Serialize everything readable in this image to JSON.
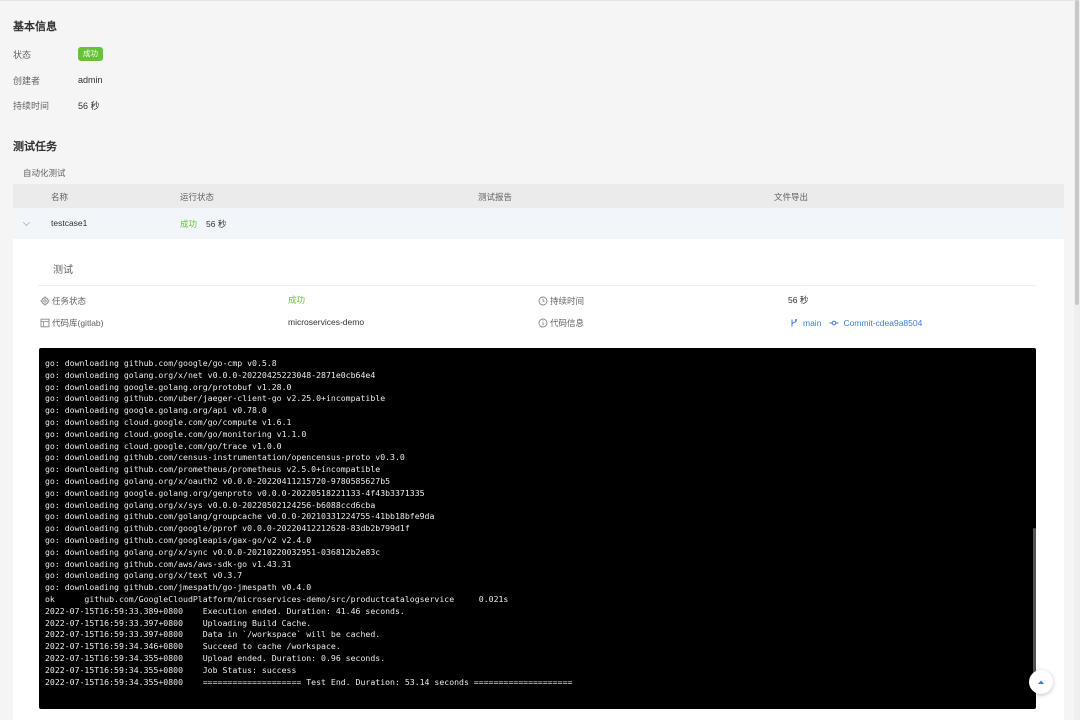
{
  "basic_info": {
    "title": "基本信息",
    "rows": [
      {
        "label": "状态",
        "value": "成功"
      },
      {
        "label": "创建者",
        "value": "admin"
      },
      {
        "label": "持续时间",
        "value": "56 秒"
      }
    ]
  },
  "test_tasks": {
    "title": "测试任务",
    "subsection": "自动化测试",
    "columns": [
      "名称",
      "运行状态",
      "测试报告",
      "文件导出"
    ],
    "row": {
      "name": "testcase1",
      "status": "成功",
      "duration": "56 秒"
    }
  },
  "detail": {
    "title": "测试",
    "task_status_label": "任务状态",
    "task_status_value": "成功",
    "duration_label": "持续时间",
    "duration_value": "56 秒",
    "repo_label": "代码库(gitlab)",
    "repo_value": "microservices-demo",
    "code_info_label": "代码信息",
    "branch": "main",
    "commit": "Commit-cdea9a8504"
  },
  "terminal_lines": [
    "go: downloading github.com/google/go-cmp v0.5.8",
    "go: downloading golang.org/x/net v0.0.0-20220425223048-2871e0cb64e4",
    "go: downloading google.golang.org/protobuf v1.28.0",
    "go: downloading github.com/uber/jaeger-client-go v2.25.0+incompatible",
    "go: downloading google.golang.org/api v0.78.0",
    "go: downloading cloud.google.com/go/compute v1.6.1",
    "go: downloading cloud.google.com/go/monitoring v1.1.0",
    "go: downloading cloud.google.com/go/trace v1.0.0",
    "go: downloading github.com/census-instrumentation/opencensus-proto v0.3.0",
    "go: downloading github.com/prometheus/prometheus v2.5.0+incompatible",
    "go: downloading golang.org/x/oauth2 v0.0.0-20220411215720-9780585627b5",
    "go: downloading google.golang.org/genproto v0.0.0-20220518221133-4f43b3371335",
    "go: downloading golang.org/x/sys v0.0.0-20220502124256-b6088ccd6cba",
    "go: downloading github.com/golang/groupcache v0.0.0-20210331224755-41bb18bfe9da",
    "go: downloading github.com/google/pprof v0.0.0-20220412212628-83db2b799d1f",
    "go: downloading github.com/googleapis/gax-go/v2 v2.4.0",
    "go: downloading golang.org/x/sync v0.0.0-20210220032951-036812b2e83c",
    "go: downloading github.com/aws/aws-sdk-go v1.43.31",
    "go: downloading golang.org/x/text v0.3.7",
    "go: downloading github.com/jmespath/go-jmespath v0.4.0",
    "ok      github.com/GoogleCloudPlatform/microservices-demo/src/productcatalogservice     0.021s",
    "2022-07-15T16:59:33.389+0800    Execution ended. Duration: 41.46 seconds.",
    "2022-07-15T16:59:33.397+0800    Uploading Build Cache.",
    "2022-07-15T16:59:33.397+0800    Data in `/workspace` will be cached.",
    "2022-07-15T16:59:34.346+0800    Succeed to cache /workspace.",
    "2022-07-15T16:59:34.355+0800    Upload ended. Duration: 0.96 seconds.",
    "2022-07-15T16:59:34.355+0800    Job Status: success",
    "2022-07-15T16:59:34.355+0800    ==================== Test End. Duration: 53.14 seconds ===================="
  ],
  "colors": {
    "success": "#67c23a",
    "link": "#3a7ce0",
    "terminal_bg": "#000000"
  },
  "icons": {
    "status": "gear-icon",
    "duration": "clock-icon",
    "repo": "repo-icon",
    "code_info": "info-icon",
    "branch": "branch-icon",
    "commit": "commit-icon",
    "back_to_top": "arrow-up-icon",
    "expand": "chevron-down-icon"
  }
}
